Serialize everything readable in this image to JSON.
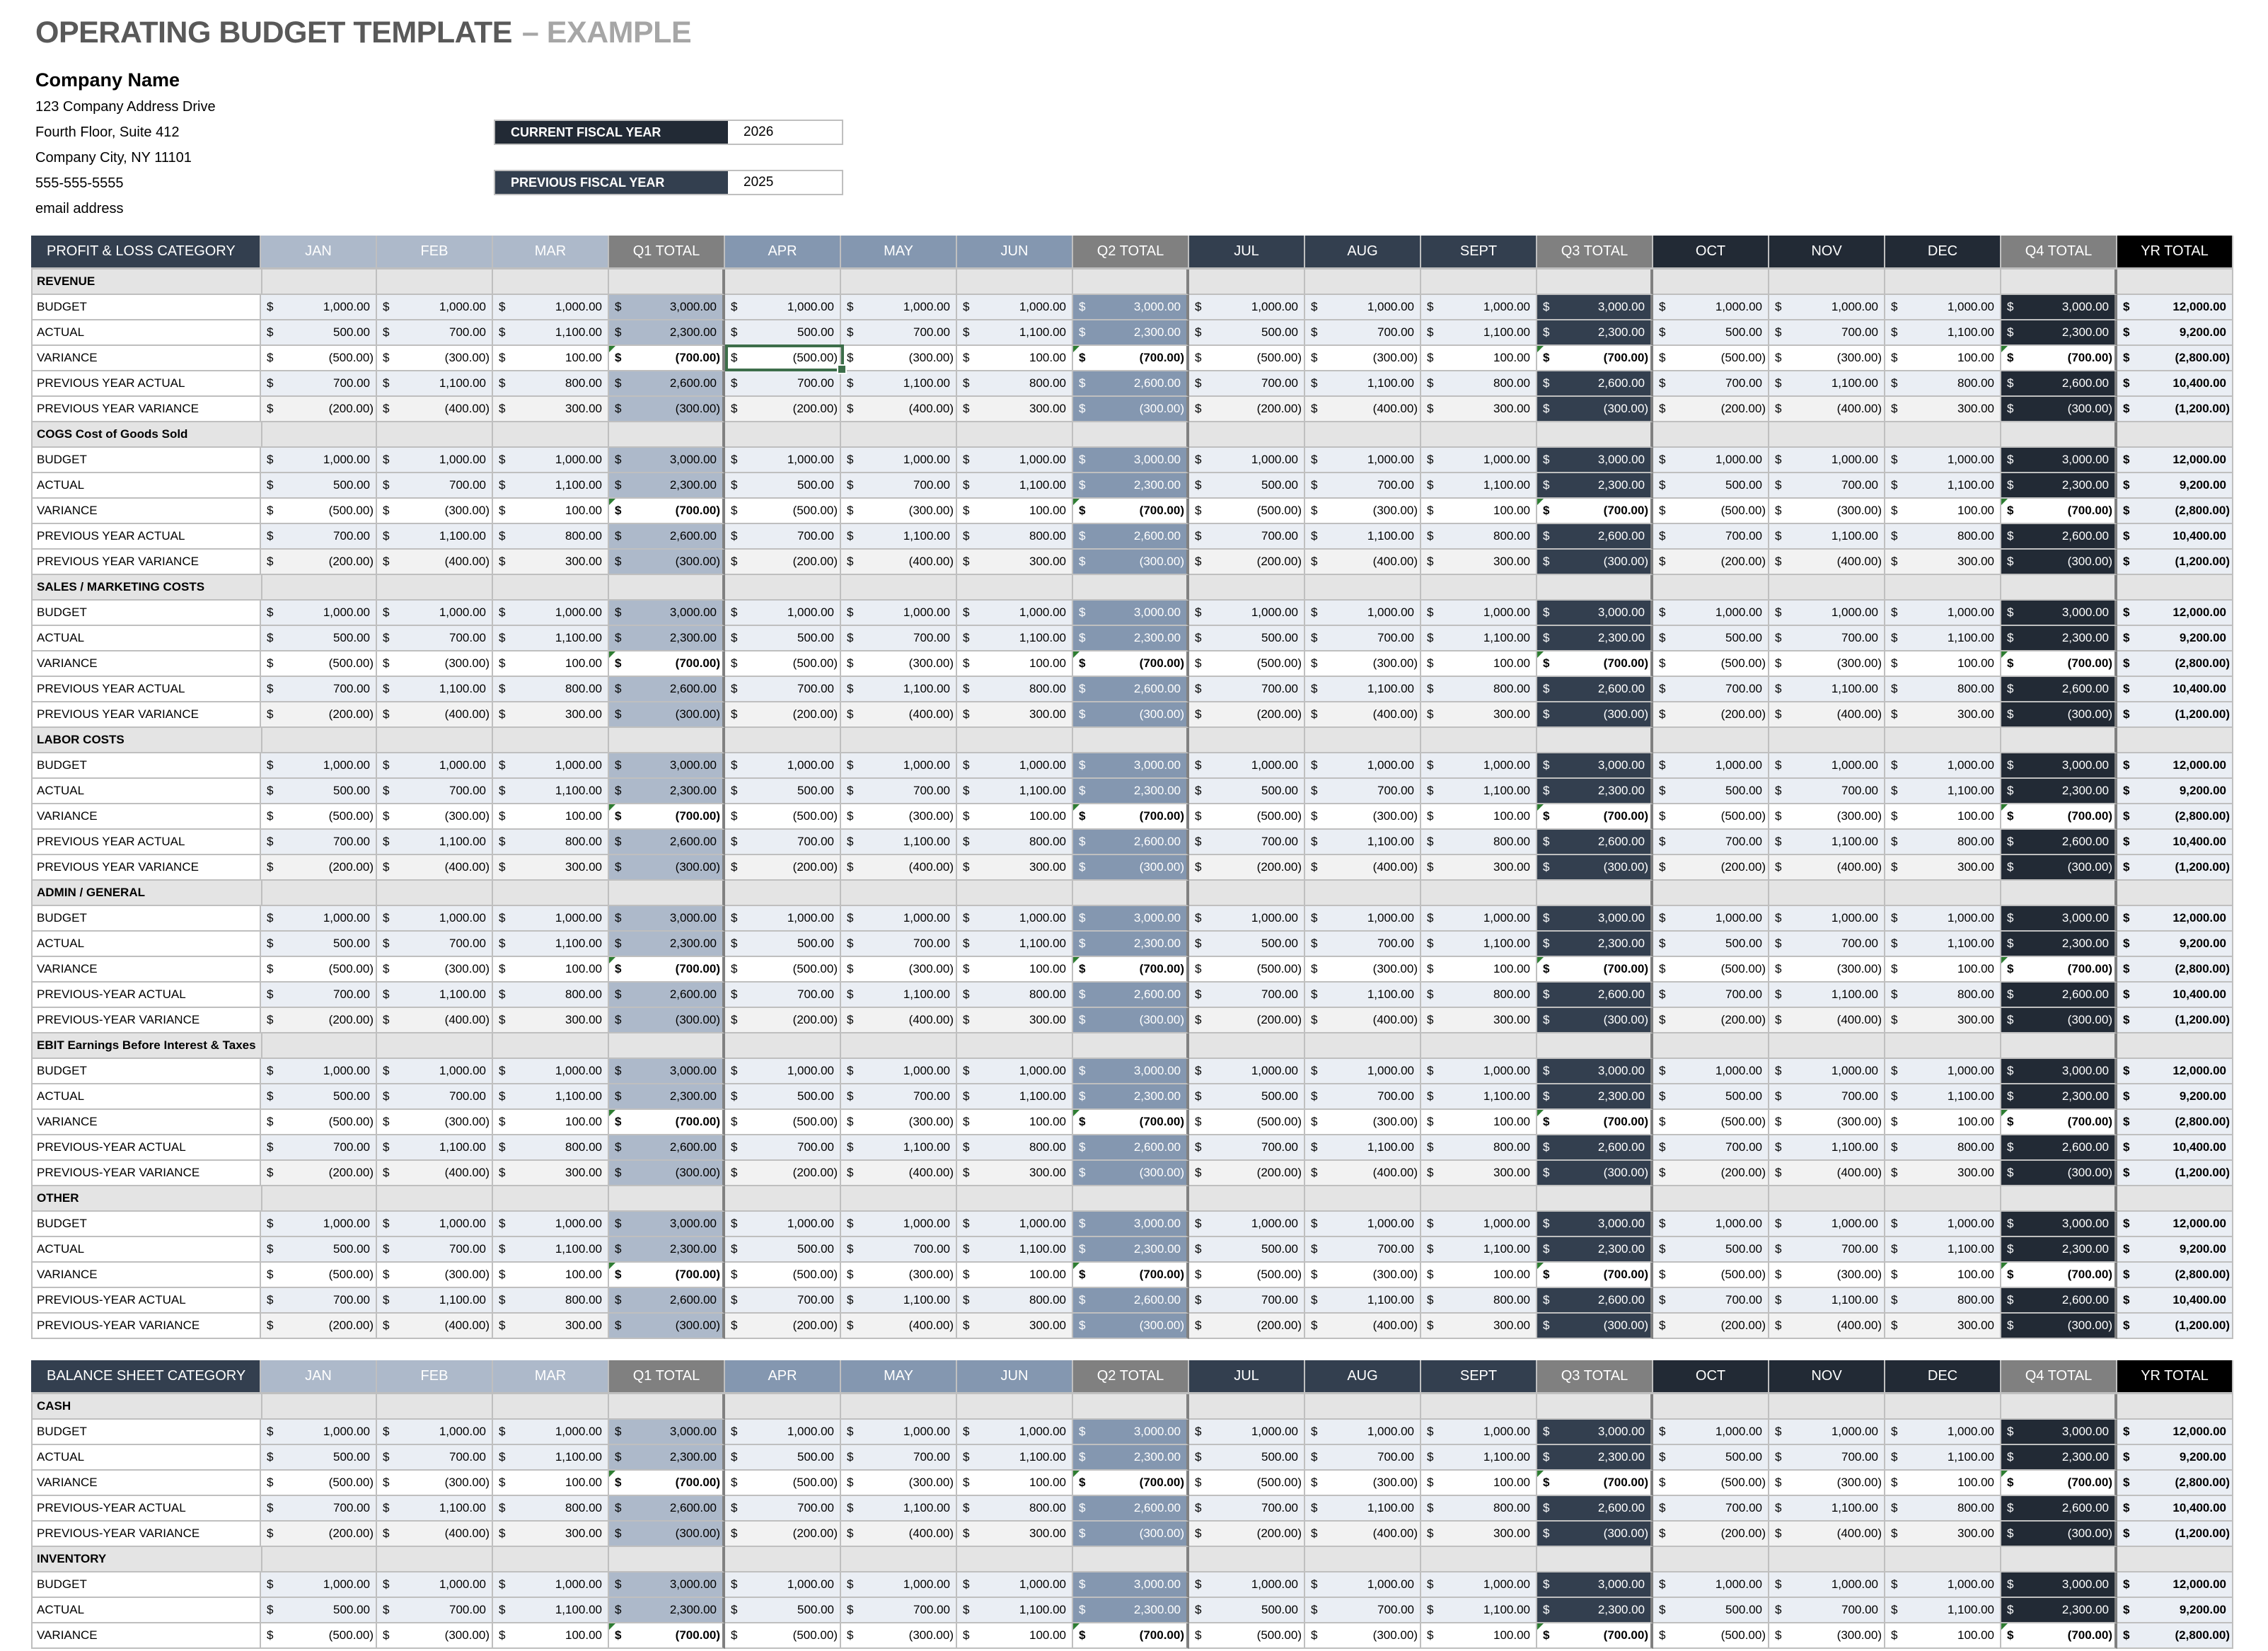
{
  "header": {
    "title": "OPERATING BUDGET TEMPLATE",
    "title_suffix": "– EXAMPLE",
    "company_name": "Company Name",
    "address_lines": [
      "123 Company Address Drive",
      "Fourth Floor, Suite 412",
      "Company City, NY  11101",
      "555-555-5555",
      "email address"
    ],
    "current_fiscal_year_label": "CURRENT FISCAL YEAR",
    "current_fiscal_year": "2026",
    "previous_fiscal_year_label": "PREVIOUS FISCAL YEAR",
    "previous_fiscal_year": "2025"
  },
  "colors": {
    "q1_months": "#ADB9CA",
    "q2_months": "#8497B0",
    "q3_months": "#333F4F",
    "q4_months": "#222A35",
    "quarter_header": "#808080",
    "year_header": "#000000",
    "category_header": "#333F4F",
    "row_tint": "#EAEEF4",
    "row_gray": "#F2F2F2",
    "section_gray": "#E4E4E4",
    "selection": "#3D6E4A"
  },
  "columns": [
    "JAN",
    "FEB",
    "MAR",
    "Q1 TOTAL",
    "APR",
    "MAY",
    "JUN",
    "Q2 TOTAL",
    "JUL",
    "AUG",
    "SEPT",
    "Q3 TOTAL",
    "OCT",
    "NOV",
    "DEC",
    "Q4 TOTAL",
    "YR TOTAL"
  ],
  "row_values": {
    "budget": [
      "1,000.00",
      "1,000.00",
      "1,000.00",
      "3,000.00",
      "1,000.00",
      "1,000.00",
      "1,000.00",
      "3,000.00",
      "1,000.00",
      "1,000.00",
      "1,000.00",
      "3,000.00",
      "1,000.00",
      "1,000.00",
      "1,000.00",
      "3,000.00",
      "12,000.00"
    ],
    "actual": [
      "500.00",
      "700.00",
      "1,100.00",
      "2,300.00",
      "500.00",
      "700.00",
      "1,100.00",
      "2,300.00",
      "500.00",
      "700.00",
      "1,100.00",
      "2,300.00",
      "500.00",
      "700.00",
      "1,100.00",
      "2,300.00",
      "9,200.00"
    ],
    "variance": [
      "(500.00)",
      "(300.00)",
      "100.00",
      "(700.00)",
      "(500.00)",
      "(300.00)",
      "100.00",
      "(700.00)",
      "(500.00)",
      "(300.00)",
      "100.00",
      "(700.00)",
      "(500.00)",
      "(300.00)",
      "100.00",
      "(700.00)",
      "(2,800.00)"
    ],
    "pya": [
      "700.00",
      "1,100.00",
      "800.00",
      "2,600.00",
      "700.00",
      "1,100.00",
      "800.00",
      "2,600.00",
      "700.00",
      "1,100.00",
      "800.00",
      "2,600.00",
      "700.00",
      "1,100.00",
      "800.00",
      "2,600.00",
      "10,400.00"
    ],
    "pyv": [
      "(200.00)",
      "(400.00)",
      "300.00",
      "(300.00)",
      "(200.00)",
      "(400.00)",
      "300.00",
      "(300.00)",
      "(200.00)",
      "(400.00)",
      "300.00",
      "(300.00)",
      "(200.00)",
      "(400.00)",
      "300.00",
      "(300.00)",
      "(1,200.00)"
    ]
  },
  "currency_symbol": "$",
  "profit_loss": {
    "category_header": "PROFIT & LOSS CATEGORY",
    "sections": [
      {
        "name": "REVENUE",
        "rows": [
          [
            "BUDGET",
            "budget"
          ],
          [
            "ACTUAL",
            "actual"
          ],
          [
            "VARIANCE",
            "variance"
          ],
          [
            "PREVIOUS YEAR ACTUAL",
            "pya"
          ],
          [
            "PREVIOUS YEAR VARIANCE",
            "pyv"
          ]
        ]
      },
      {
        "name": "COGS Cost of Goods Sold",
        "rows": [
          [
            "BUDGET",
            "budget"
          ],
          [
            "ACTUAL",
            "actual"
          ],
          [
            "VARIANCE",
            "variance"
          ],
          [
            "PREVIOUS YEAR ACTUAL",
            "pya"
          ],
          [
            "PREVIOUS YEAR VARIANCE",
            "pyv"
          ]
        ]
      },
      {
        "name": "SALES / MARKETING COSTS",
        "rows": [
          [
            "BUDGET",
            "budget"
          ],
          [
            "ACTUAL",
            "actual"
          ],
          [
            "VARIANCE",
            "variance"
          ],
          [
            "PREVIOUS YEAR ACTUAL",
            "pya"
          ],
          [
            "PREVIOUS YEAR VARIANCE",
            "pyv"
          ]
        ]
      },
      {
        "name": "LABOR COSTS",
        "rows": [
          [
            "BUDGET",
            "budget"
          ],
          [
            "ACTUAL",
            "actual"
          ],
          [
            "VARIANCE",
            "variance"
          ],
          [
            "PREVIOUS YEAR ACTUAL",
            "pya"
          ],
          [
            "PREVIOUS YEAR VARIANCE",
            "pyv"
          ]
        ]
      },
      {
        "name": "ADMIN / GENERAL",
        "rows": [
          [
            "BUDGET",
            "budget"
          ],
          [
            "ACTUAL",
            "actual"
          ],
          [
            "VARIANCE",
            "variance"
          ],
          [
            "PREVIOUS-YEAR ACTUAL",
            "pya"
          ],
          [
            "PREVIOUS-YEAR VARIANCE",
            "pyv"
          ]
        ]
      },
      {
        "name": "EBIT Earnings Before Interest & Taxes",
        "rows": [
          [
            "BUDGET",
            "budget"
          ],
          [
            "ACTUAL",
            "actual"
          ],
          [
            "VARIANCE",
            "variance"
          ],
          [
            "PREVIOUS-YEAR ACTUAL",
            "pya"
          ],
          [
            "PREVIOUS-YEAR VARIANCE",
            "pyv"
          ]
        ]
      },
      {
        "name": "OTHER",
        "rows": [
          [
            "BUDGET",
            "budget"
          ],
          [
            "ACTUAL",
            "actual"
          ],
          [
            "VARIANCE",
            "variance"
          ],
          [
            "PREVIOUS-YEAR ACTUAL",
            "pya"
          ],
          [
            "PREVIOUS-YEAR VARIANCE",
            "pyv"
          ]
        ]
      }
    ]
  },
  "balance_sheet": {
    "category_header": "BALANCE SHEET CATEGORY",
    "sections": [
      {
        "name": "CASH",
        "rows": [
          [
            "BUDGET",
            "budget"
          ],
          [
            "ACTUAL",
            "actual"
          ],
          [
            "VARIANCE",
            "variance"
          ],
          [
            "PREVIOUS-YEAR ACTUAL",
            "pya"
          ],
          [
            "PREVIOUS-YEAR VARIANCE",
            "pyv"
          ]
        ]
      },
      {
        "name": "INVENTORY",
        "rows": [
          [
            "BUDGET",
            "budget"
          ],
          [
            "ACTUAL",
            "actual"
          ],
          [
            "VARIANCE",
            "variance"
          ]
        ]
      }
    ]
  },
  "selected_cell": {
    "section": "REVENUE",
    "row": "VARIANCE",
    "column": "APR",
    "value": "(500.00)"
  }
}
